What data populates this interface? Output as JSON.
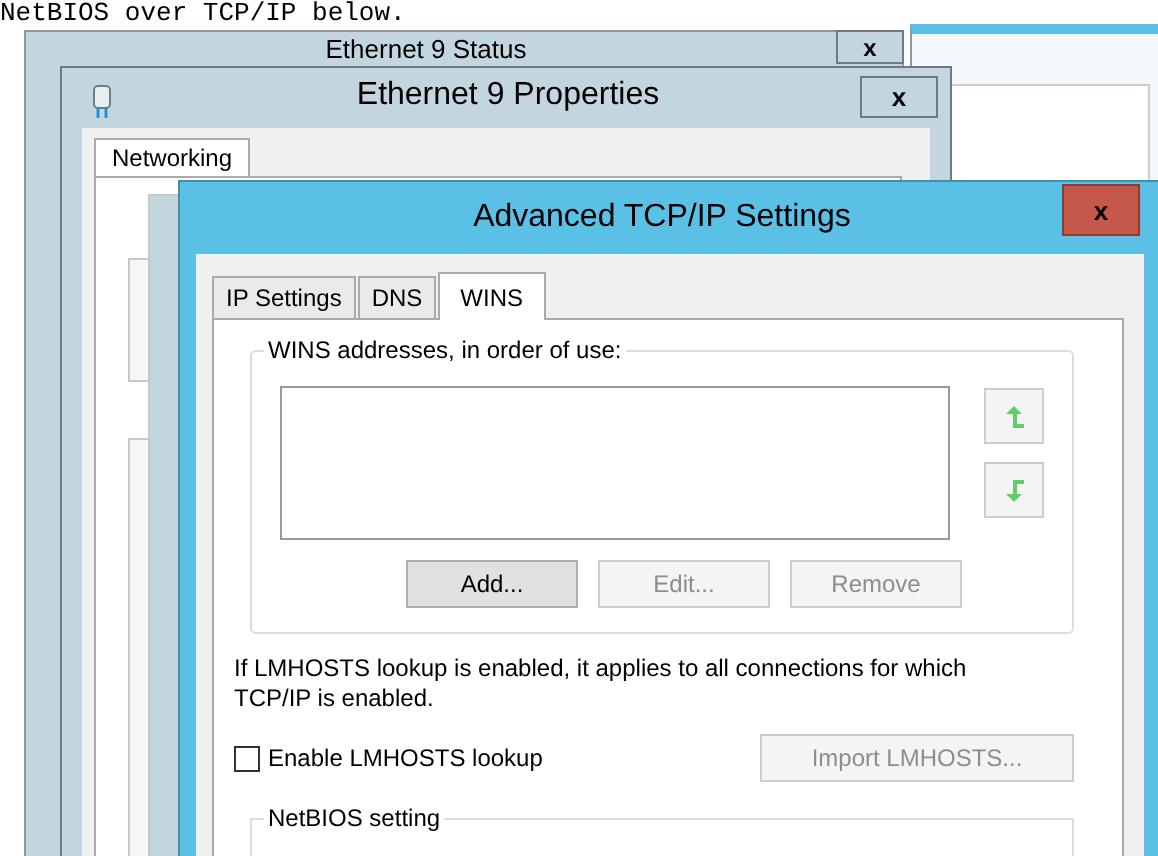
{
  "background_text": "NetBIOS over TCP/IP below.",
  "status_window": {
    "title": "Ethernet 9 Status",
    "close": "x"
  },
  "properties_window": {
    "title": "Ethernet 9 Properties",
    "close": "x",
    "tabs": [
      {
        "label": "Networking",
        "selected": true
      }
    ]
  },
  "advanced_window": {
    "title": "Advanced TCP/IP Settings",
    "close": "x",
    "tabs": [
      {
        "label": "IP Settings",
        "selected": false
      },
      {
        "label": "DNS",
        "selected": false
      },
      {
        "label": "WINS",
        "selected": true
      }
    ],
    "wins_group": {
      "label": "WINS addresses, in order of use:",
      "buttons": [
        {
          "label": "Add...",
          "disabled": false
        },
        {
          "label": "Edit...",
          "disabled": true
        },
        {
          "label": "Remove",
          "disabled": true
        }
      ]
    },
    "info_text": "If LMHOSTS lookup is enabled, it applies to all connections for which TCP/IP is enabled.",
    "lmhosts_checkbox": {
      "label": "Enable LMHOSTS lookup",
      "checked": false
    },
    "import_button": {
      "label": "Import LMHOSTS...",
      "disabled": true
    },
    "netbios_group": {
      "label": "NetBIOS setting"
    }
  }
}
